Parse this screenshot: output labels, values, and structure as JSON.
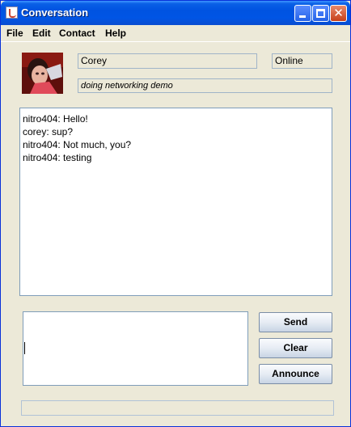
{
  "window": {
    "title": "Conversation",
    "controls": [
      "minimize-icon",
      "maximize-icon",
      "close-icon"
    ]
  },
  "menu": [
    "File",
    "Edit",
    "Contact",
    "Help"
  ],
  "contact": {
    "name": "Corey",
    "status": "Online",
    "status_message": "doing networking demo"
  },
  "chat_log": [
    "nitro404: Hello!",
    "corey: sup?",
    "nitro404: Not much, you?",
    "nitro404: testing"
  ],
  "message_input": {
    "value": ""
  },
  "buttons": {
    "send": "Send",
    "clear": "Clear",
    "announce": "Announce"
  },
  "status_bar": {
    "text": ""
  }
}
